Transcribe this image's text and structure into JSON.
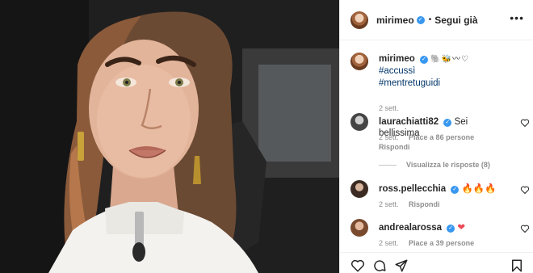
{
  "post": {
    "author": "mirimeo",
    "follow_separator": "•",
    "follow_label": "Segui già",
    "more_label": "•••"
  },
  "caption": {
    "username": "mirimeo",
    "emoji": "🐘🐝〰♡",
    "hashtags": [
      "#accussì",
      "#mentretuguidi"
    ],
    "time": "2 sett."
  },
  "comments": [
    {
      "username": "laurachiatti82",
      "text": "Sei bellissima",
      "time": "2 sett.",
      "likes": "Piace a 86 persone",
      "reply_label": "Rispondi",
      "view_replies": "Visualizza le risposte (8)"
    },
    {
      "username": "ross.pellecchia",
      "text": "🔥🔥🔥",
      "time": "2 sett.",
      "reply_label": "Rispondi"
    },
    {
      "username": "andrealarossa",
      "text": "❤",
      "time": "2 sett.",
      "likes": "Piace a 39 persone"
    }
  ],
  "colors": {
    "verified": "#3897f0",
    "hashtag": "#003569",
    "meta": "#8e8e8e",
    "heart_red": "#ed4956"
  },
  "icons": [
    "heart-icon",
    "comment-icon",
    "share-icon",
    "bookmark-icon",
    "more-icon",
    "verified-icon"
  ]
}
